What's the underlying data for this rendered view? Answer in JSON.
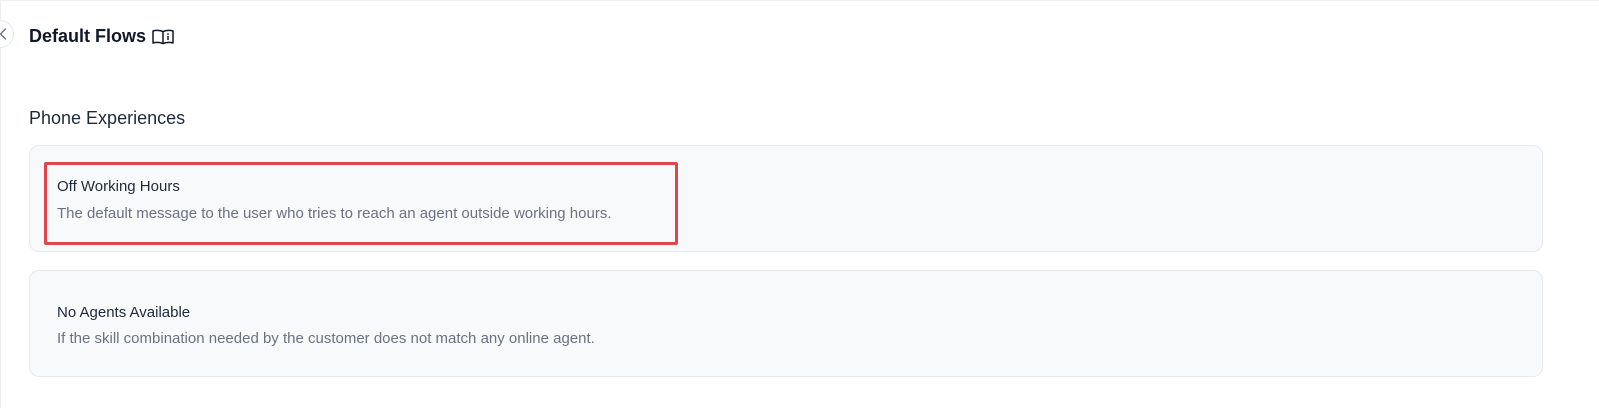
{
  "header": {
    "title": "Default Flows",
    "back_icon": "chevron-left-icon",
    "info_icon": "book-info-icon"
  },
  "section": {
    "title": "Phone Experiences"
  },
  "flows": [
    {
      "title": "Off Working Hours",
      "description": "The default message to the user who tries to reach an agent outside working hours."
    },
    {
      "title": "No Agents Available",
      "description": "If the skill combination needed by the customer does not match any online agent."
    }
  ],
  "colors": {
    "highlight": "#e0474c",
    "card_background": "#f8f9fb",
    "muted_text": "#6b7280"
  }
}
